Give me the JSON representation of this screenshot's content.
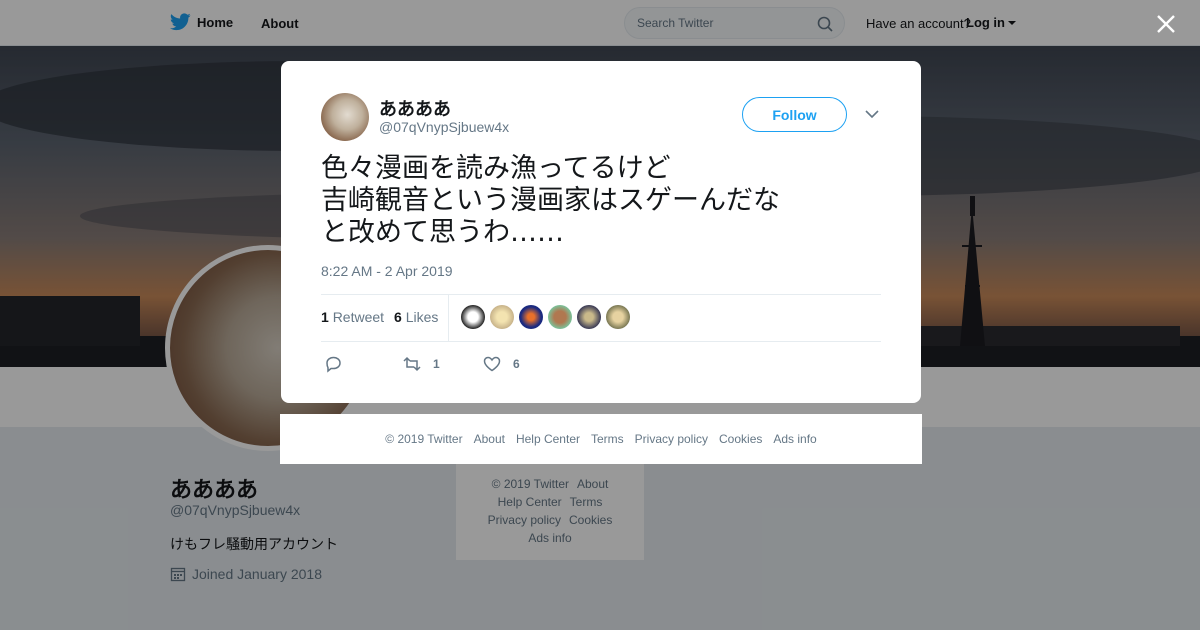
{
  "nav": {
    "home": "Home",
    "about": "About",
    "search_placeholder": "Search Twitter",
    "have_account": "Have an account?",
    "login": "Log in"
  },
  "profile": {
    "name": "ああああ",
    "handle": "@07qVnypSjbuew4x",
    "bio": "けもフレ騒動用アカウント",
    "joined": "Joined January 2018"
  },
  "side_footer": {
    "line1": [
      "© 2019 Twitter",
      "About"
    ],
    "line2": [
      "Help Center",
      "Terms"
    ],
    "line3": [
      "Privacy policy",
      "Cookies"
    ],
    "line4": [
      "Ads info"
    ]
  },
  "tweet": {
    "name": "ああああ",
    "handle": "@07qVnypSjbuew4x",
    "follow": "Follow",
    "text_lines": [
      "色々漫画を読み漁ってるけど",
      "吉崎観音という漫画家はスゲーんだな",
      "と改めて思うわ……"
    ],
    "time": "8:22 AM - 2 Apr 2019",
    "retweet_count": "1",
    "retweet_label": "Retweet",
    "like_count": "6",
    "like_label": "Likes",
    "action_retweets": "1",
    "action_likes": "6"
  },
  "modal_footer": [
    "© 2019 Twitter",
    "About",
    "Help Center",
    "Terms",
    "Privacy policy",
    "Cookies",
    "Ads info"
  ],
  "colors": {
    "accent": "#1da1f2",
    "muted": "#657786",
    "text": "#14171a"
  }
}
